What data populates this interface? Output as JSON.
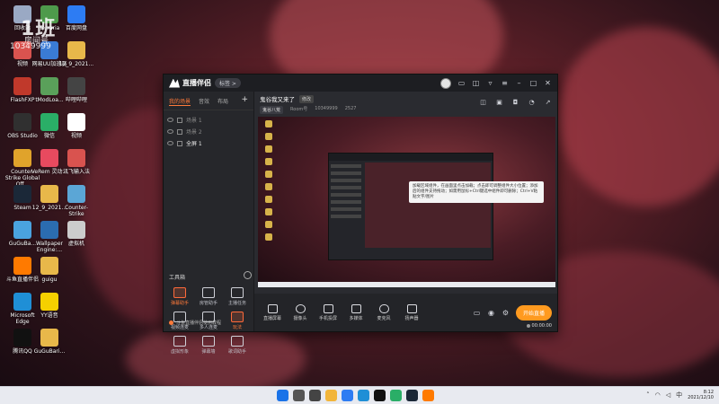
{
  "watermark": {
    "title": "1班",
    "subtitle": "房间号",
    "room_id": "10349999"
  },
  "desktop_icons": [
    {
      "label": "回收站",
      "color": "#9aa9c4"
    },
    {
      "label": "视频",
      "color": "#d9534f"
    },
    {
      "label": "FlashFXP",
      "color": "#c0392b"
    },
    {
      "label": "OBS Studio",
      "color": "#303030"
    },
    {
      "label": "Counter-Strike Global Off...",
      "color": "#e0a32b"
    },
    {
      "label": "Steam",
      "color": "#1b2838"
    },
    {
      "label": "GuGuBa...",
      "color": "#4aa3df"
    },
    {
      "label": "斗鱼直播伴侣",
      "color": "#ff7a00"
    },
    {
      "label": "Microsoft Edge",
      "color": "#1f8fd6"
    },
    {
      "label": "腾讯QQ",
      "color": "#111111"
    },
    {
      "label": "Terraria",
      "color": "#4e9a4b"
    },
    {
      "label": "网易UU加速器",
      "color": "#3a7bd5"
    },
    {
      "label": "tModLoa...",
      "color": "#5aa05a"
    },
    {
      "label": "微信",
      "color": "#2aae67"
    },
    {
      "label": "VeRem 灵动...",
      "color": "#e84a5f"
    },
    {
      "label": "12_9_2021...",
      "color": "#e8b84a"
    },
    {
      "label": "Wallpaper Engine:...",
      "color": "#2b6cb0"
    },
    {
      "label": "guigu",
      "color": "#e8b84a"
    },
    {
      "label": "YY语音",
      "color": "#f5d000"
    },
    {
      "label": "GuGuBari...",
      "color": "#e8b84a"
    },
    {
      "label": "百度网盘",
      "color": "#2d7cf3"
    },
    {
      "label": "12_9_2021...",
      "color": "#e8b84a"
    },
    {
      "label": "哔哩哔哩",
      "color": "#444444"
    },
    {
      "label": "视频",
      "color": "#ffffff"
    },
    {
      "label": "讯飞输入法",
      "color": "#d9534f"
    },
    {
      "label": "Counter-Strike",
      "color": "#5ba6d6"
    },
    {
      "label": "虚拟机",
      "color": "#cccccc"
    }
  ],
  "app": {
    "name": "直播伴侣",
    "version_pill": "标签 >",
    "tabs": [
      "我的场景",
      "音效",
      "布局"
    ],
    "scenes": [
      {
        "label": "场景 1",
        "on": false
      },
      {
        "label": "场景 2",
        "on": false
      },
      {
        "label": "全屏 1",
        "on": true
      }
    ],
    "tools_title": "工具箱",
    "tools": [
      {
        "label": "弹幕助手",
        "hot": true
      },
      {
        "label": "房管助手",
        "hot": false
      },
      {
        "label": "主播任务",
        "hot": false
      },
      {
        "label": "视频连麦",
        "hot": false
      },
      {
        "label": "多人连麦",
        "hot": false
      },
      {
        "label": "玩法",
        "hot": true
      },
      {
        "label": "虚拟形象",
        "hot": false
      },
      {
        "label": "弹幕墙",
        "hot": false
      },
      {
        "label": "歌词助手",
        "hot": false
      }
    ],
    "notice": "斗鱼直播伴侣使用教程",
    "stream_title": "鬼谷我又来了",
    "title_chip": "修改",
    "category": "鬼谷八荒",
    "room_label": "Room号",
    "room_no": "10349999",
    "fans": "2527",
    "tooltip": "加载区域组件，在画面里点击加载；点击即可调整组件大小位置；添加后的组件支持拖动；如需用鼠标+Ctrl键选中组件即可删除；Ctrl+V粘贴文字/图片",
    "controls": [
      {
        "label": "直播屏幕"
      },
      {
        "label": "摄像头"
      },
      {
        "label": "手机投屏"
      },
      {
        "label": "多媒体"
      },
      {
        "label": "麦克风"
      },
      {
        "label": "扬声器"
      }
    ],
    "start_button": "开始直播",
    "timer": "00:00:00"
  },
  "taskbar": {
    "apps": [
      {
        "name": "start-icon",
        "color": "#1a73e8"
      },
      {
        "name": "search-icon",
        "color": "#555555"
      },
      {
        "name": "taskview-icon",
        "color": "#444444"
      },
      {
        "name": "explorer-icon",
        "color": "#f2b53a"
      },
      {
        "name": "store-icon",
        "color": "#2d7cf3"
      },
      {
        "name": "edge-icon",
        "color": "#1f8fd6"
      },
      {
        "name": "qq-icon",
        "color": "#111111"
      },
      {
        "name": "wechat-icon",
        "color": "#2aae67"
      },
      {
        "name": "steam-icon",
        "color": "#1b2838"
      },
      {
        "name": "douyu-icon",
        "color": "#ff7a00"
      }
    ],
    "time": "8:12",
    "date": "2021/12/10"
  }
}
